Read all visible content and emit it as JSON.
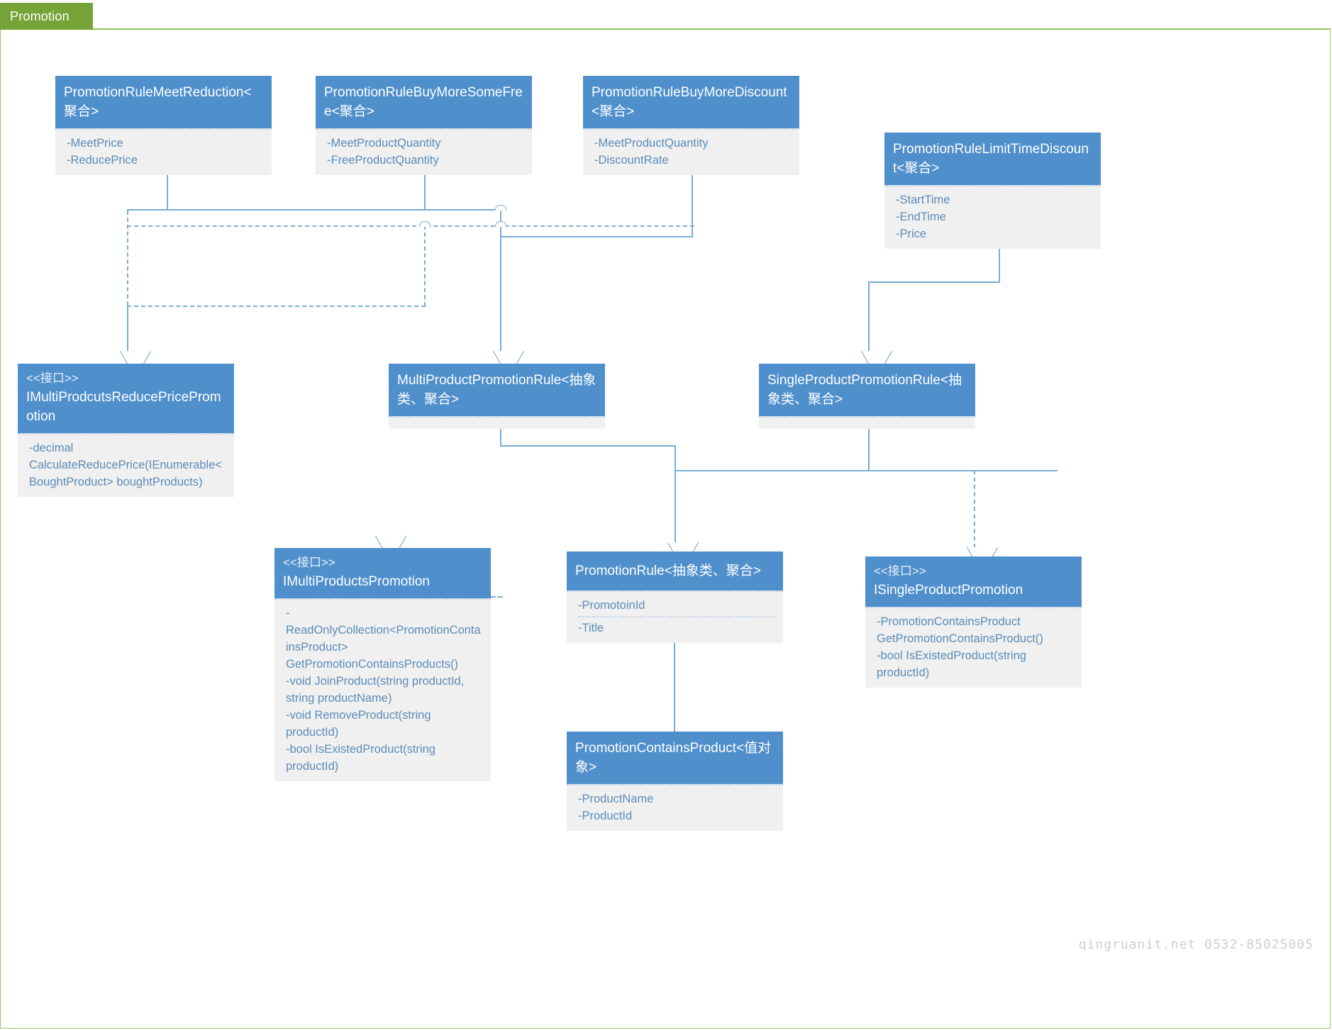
{
  "package": {
    "tab_label": "Promotion"
  },
  "watermark": "qingruanit.net 0532-85025005",
  "classes": {
    "meet_reduction": {
      "title": "PromotionRuleMeetReduction<聚合>",
      "members": [
        "-MeetPrice",
        "-ReducePrice"
      ]
    },
    "buy_more_some_free": {
      "title": "PromotionRuleBuyMoreSomeFree<聚合>",
      "members": [
        "-MeetProductQuantity",
        "-FreeProductQuantity"
      ]
    },
    "buy_more_discount": {
      "title": "PromotionRuleBuyMoreDiscount<聚合>",
      "members": [
        "-MeetProductQuantity",
        "-DiscountRate"
      ]
    },
    "limit_time_discount": {
      "title": "PromotionRuleLimitTimeDiscount<聚合>",
      "members": [
        "-StartTime",
        "-EndTime",
        "-Price"
      ]
    },
    "imulti_reduce_price": {
      "stereotype": "<<接口>>",
      "title": "IMultiProdcutsReducePricePromotion",
      "members": [
        "-decimal CalculateReducePrice(IEnumerable<BoughtProduct> boughtProducts)"
      ]
    },
    "multi_product_rule": {
      "title": "MultiProductPromotionRule<抽象类、聚合>",
      "members": []
    },
    "single_product_rule": {
      "title": "SingleProductPromotionRule<抽象类、聚合>",
      "members": []
    },
    "imulti_products_promotion": {
      "stereotype": "<<接口>>",
      "title": "IMultiProductsPromotion",
      "members": [
        "-ReadOnlyCollection<PromotionContainsProduct> GetPromotionContainsProducts()",
        "-void JoinProduct(string productId, string productName)",
        "-void RemoveProduct(string productId)",
        "-bool IsExistedProduct(string productId)"
      ]
    },
    "promotion_rule": {
      "title": "PromotionRule<抽象类、聚合>",
      "members": [
        "-PromotoinId",
        "-Title"
      ]
    },
    "isingle_product_promotion": {
      "stereotype": "<<接口>>",
      "title": "ISingleProductPromotion",
      "members": [
        "-PromotionContainsProduct GetPromotionContainsProduct()",
        "-bool IsExistedProduct(string productId)"
      ]
    },
    "promotion_contains_product": {
      "title": "PromotionContainsProduct<值对象>",
      "members": [
        "-ProductName",
        "-ProductId"
      ]
    }
  },
  "colors": {
    "header_blue": "#4f8fcc",
    "body_gray": "#f0f0f0",
    "member_text": "#5b8cb8",
    "connector": "#7aadd4",
    "package_green": "#76a338",
    "frame_green": "#9fc766"
  }
}
